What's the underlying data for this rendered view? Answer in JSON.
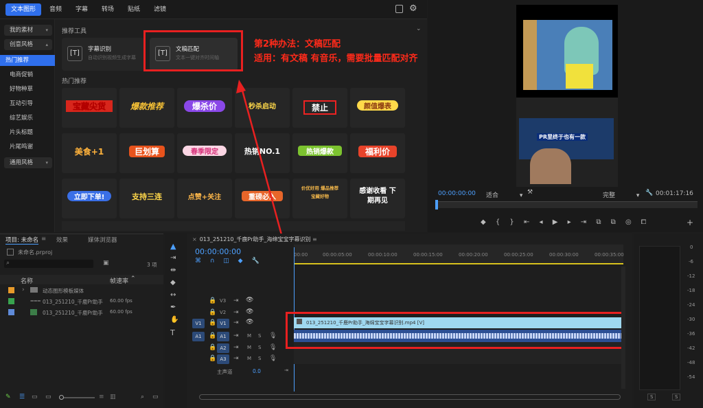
{
  "plugin": {
    "tabs": [
      "文本图形",
      "音频",
      "字幕",
      "转场",
      "贴纸",
      "滤镜"
    ],
    "sidebar": {
      "my_assets": "我的素材",
      "creative": "创意风格",
      "items": [
        "热门推荐",
        "电商促销",
        "好物种草",
        "互动引导",
        "综艺娱乐",
        "片头标题",
        "片尾鸣谢"
      ],
      "general": "通用风格"
    },
    "recommended_tools": "推荐工具",
    "tool1_title": "字幕识别",
    "tool1_sub": "自动识别视频生成字幕",
    "tool2_title": "文稿匹配",
    "tool2_sub": "文本一键对齐时间轴",
    "hot": "热门推荐",
    "stickers": [
      "宝藏尖货",
      "爆款推荐",
      "爆杀价",
      "秒杀启动",
      "禁止",
      "颜值爆表",
      "美食+1",
      "巨划算",
      "春季限定",
      "热销NO.1",
      "热销爆款",
      "福利价",
      "立即下单!",
      "支持三连",
      "点赞+关注",
      "重磅必入",
      "价优好用 爆品推荐 宝藏好物",
      "感谢收看 下期再见"
    ]
  },
  "annotation": {
    "line1": "第2种办法：文稿匹配",
    "line2": "适用：有文稿 有音乐，需要批量匹配对齐"
  },
  "preview": {
    "timecode": "00:00:00:00",
    "fit": "适合",
    "quality": "完整",
    "duration": "00:01:17:16",
    "video_caption": "PR里终于也有一款"
  },
  "project": {
    "tabs": [
      "项目: 未命名",
      "效果",
      "媒体浏览器"
    ],
    "file": "未命名.prproj",
    "count": "3 项",
    "col_name": "名称",
    "col_fps": "帧速率",
    "rows": [
      {
        "name": "动态图形模板媒体",
        "fps": ""
      },
      {
        "name": "013_251210_千鹿Pr助手",
        "fps": "60.00 fps"
      },
      {
        "name": "013_251210_千鹿Pr助手",
        "fps": "60.00 fps"
      }
    ]
  },
  "timeline": {
    "title": "013_251210_千鹿Pr助手_海绵宝宝字幕识别",
    "timecode": "00:00:00:00",
    "ruler": [
      "00:00",
      "00:00:05:00",
      "00:00:10:00",
      "00:00:15:00",
      "00:00:20:00",
      "00:00:25:00",
      "00:00:30:00",
      "00:00:35:00"
    ],
    "tracks": [
      "V3",
      "V2",
      "V1",
      "A1",
      "A2",
      "A3"
    ],
    "master": "主声道",
    "master_val": "0.0",
    "clip": "013_251210_千鹿Pr助手_海绵宝宝字幕识别.mp4 [V]"
  },
  "meter": {
    "labels": [
      "0",
      "-6",
      "-12",
      "-18",
      "-24",
      "-30",
      "-36",
      "-42",
      "-48",
      "-54"
    ],
    "s": "S"
  }
}
